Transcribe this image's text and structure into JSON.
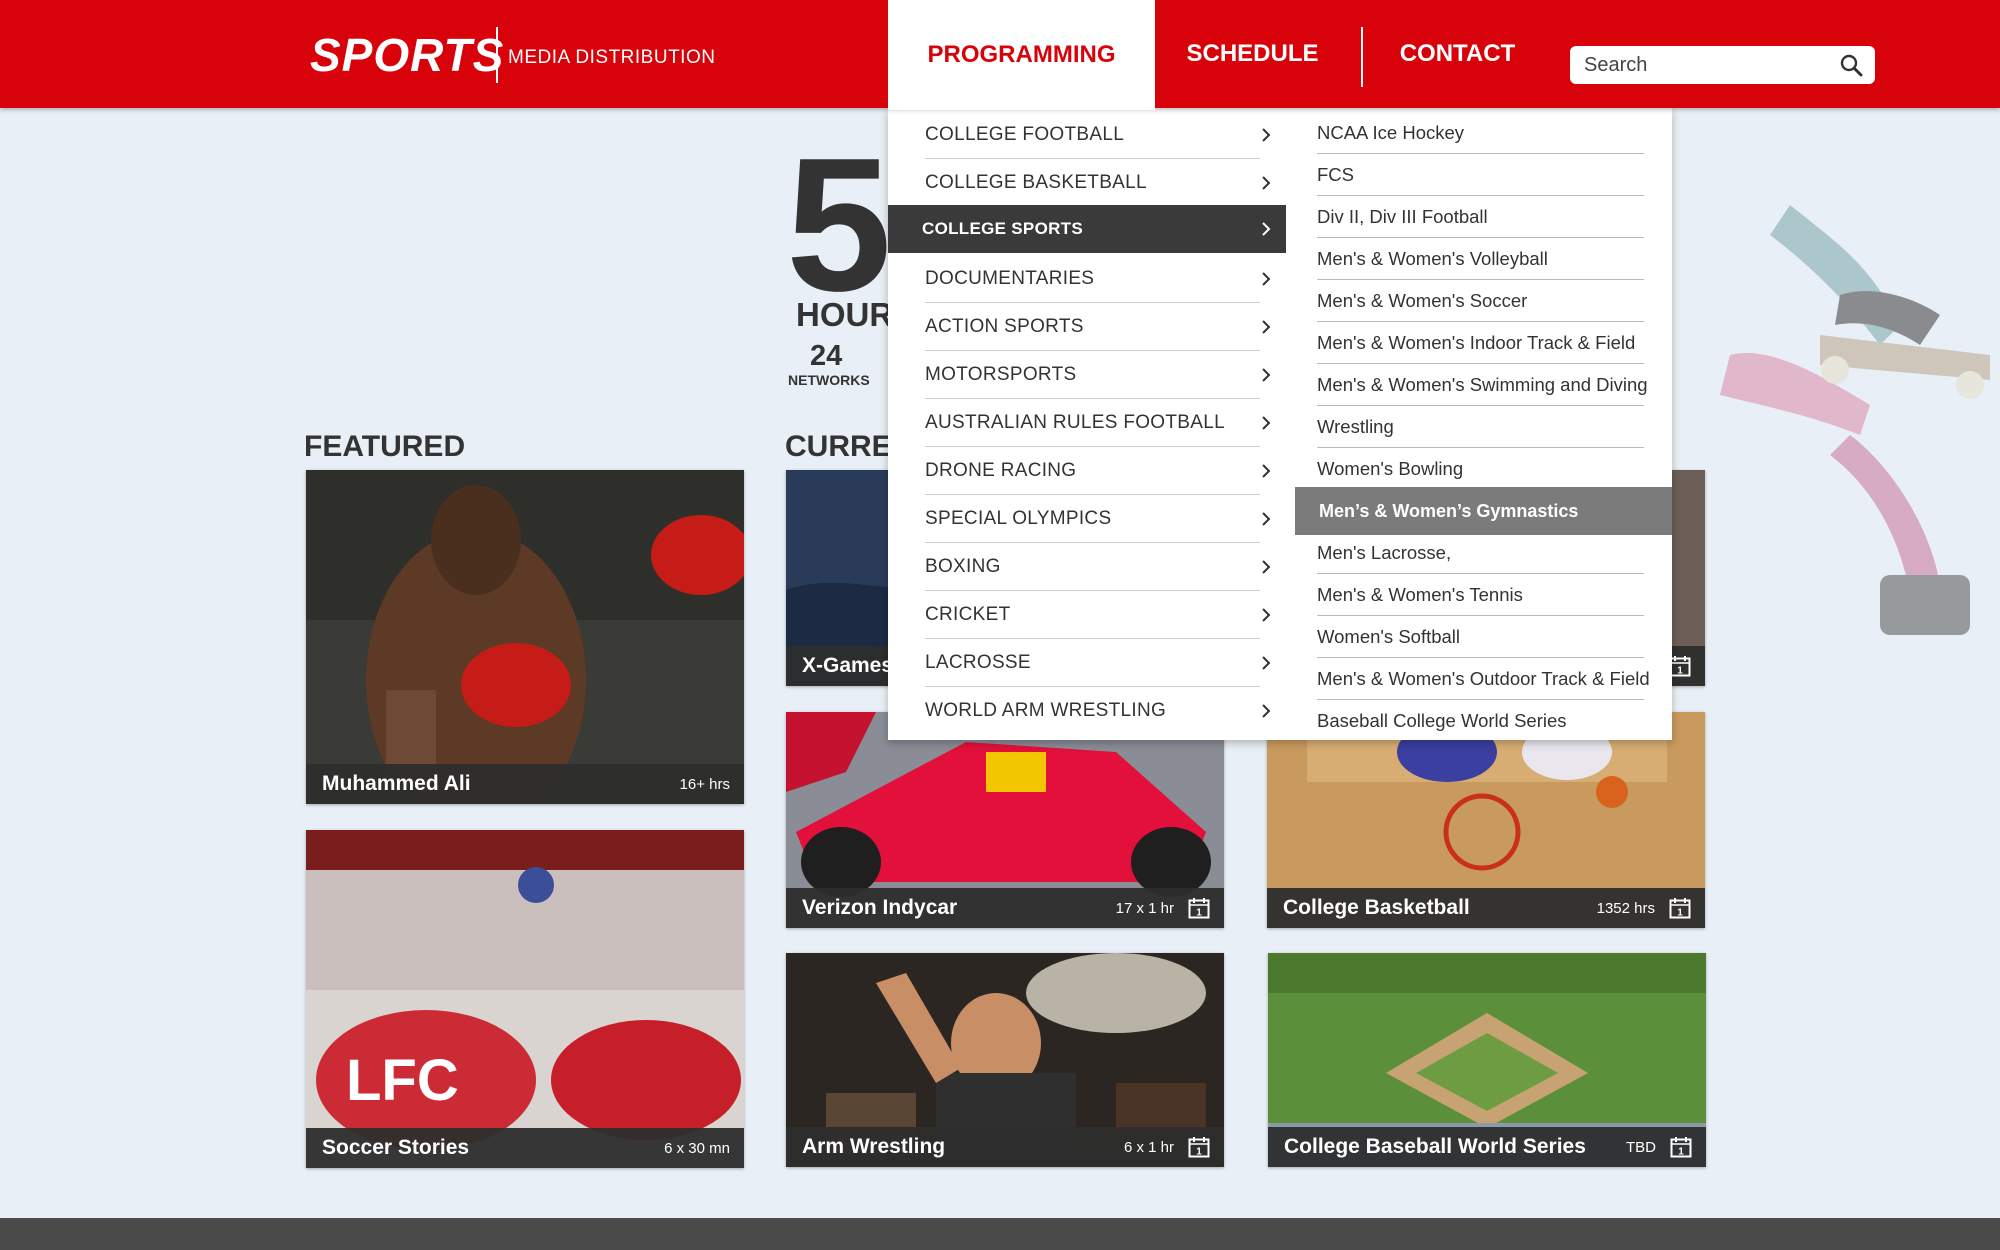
{
  "header": {
    "logo": "SPORTS",
    "logo_sub": "MEDIA DISTRIBUTION",
    "nav": {
      "programming": "PROGRAMMING",
      "schedule": "SCHEDULE",
      "contact": "CONTACT"
    },
    "search_placeholder": "Search"
  },
  "hero": {
    "big_number": "5",
    "hours_label": "HOUR",
    "networks_count": "24",
    "networks_label": "NETWORKS"
  },
  "sections": {
    "featured": "FEATURED",
    "current": "CURREI"
  },
  "cards": {
    "ali": {
      "title": "Muhammed Ali",
      "meta": "16+ hrs"
    },
    "soccer": {
      "title": "Soccer Stories",
      "meta": "6 x 30 mn"
    },
    "xgames": {
      "title": "X-Games"
    },
    "indycar": {
      "title": "Verizon Indycar",
      "meta": "17 x 1 hr"
    },
    "armwrestling": {
      "title": "Arm Wrestling",
      "meta": "6 x 1 hr"
    },
    "basketball": {
      "title": "College Basketball",
      "meta": "1352 hrs"
    },
    "baseball": {
      "title": "College Baseball World Series",
      "meta": "TBD"
    }
  },
  "calendar_day": "1",
  "menu": {
    "items": [
      "COLLEGE FOOTBALL",
      "COLLEGE BASKETBALL",
      "COLLEGE SPORTS",
      "DOCUMENTARIES",
      "ACTION SPORTS",
      "MOTORSPORTS",
      "AUSTRALIAN RULES FOOTBALL",
      "DRONE RACING",
      "SPECIAL OLYMPICS",
      "BOXING",
      "CRICKET",
      "LACROSSE",
      "WORLD ARM WRESTLING"
    ],
    "active": "COLLEGE SPORTS"
  },
  "submenu": {
    "items": [
      "NCAA Ice Hockey",
      "FCS",
      "Div II, Div III Football",
      "Men's & Women's Volleyball",
      "Men's & Women's Soccer",
      "Men's & Women's Indoor Track & Field",
      "Men's & Women's Swimming and Diving",
      "Wrestling",
      "Women's Bowling",
      "Men’s & Women’s Gymnastics",
      "Men's Lacrosse,",
      "Men's & Women's Tennis",
      "Women's Softball",
      "Men's & Women's Outdoor Track & Field",
      "Baseball College World Series"
    ],
    "active": "Men’s & Women’s Gymnastics"
  },
  "colors": {
    "brand_red": "#d8030a",
    "menu_active": "#3a3a3a",
    "submenu_active": "#7b7b7b",
    "background": "#e9eff6"
  },
  "icons": {
    "search": "search-icon",
    "chevron": "chevron-right-icon",
    "calendar": "calendar-icon"
  }
}
